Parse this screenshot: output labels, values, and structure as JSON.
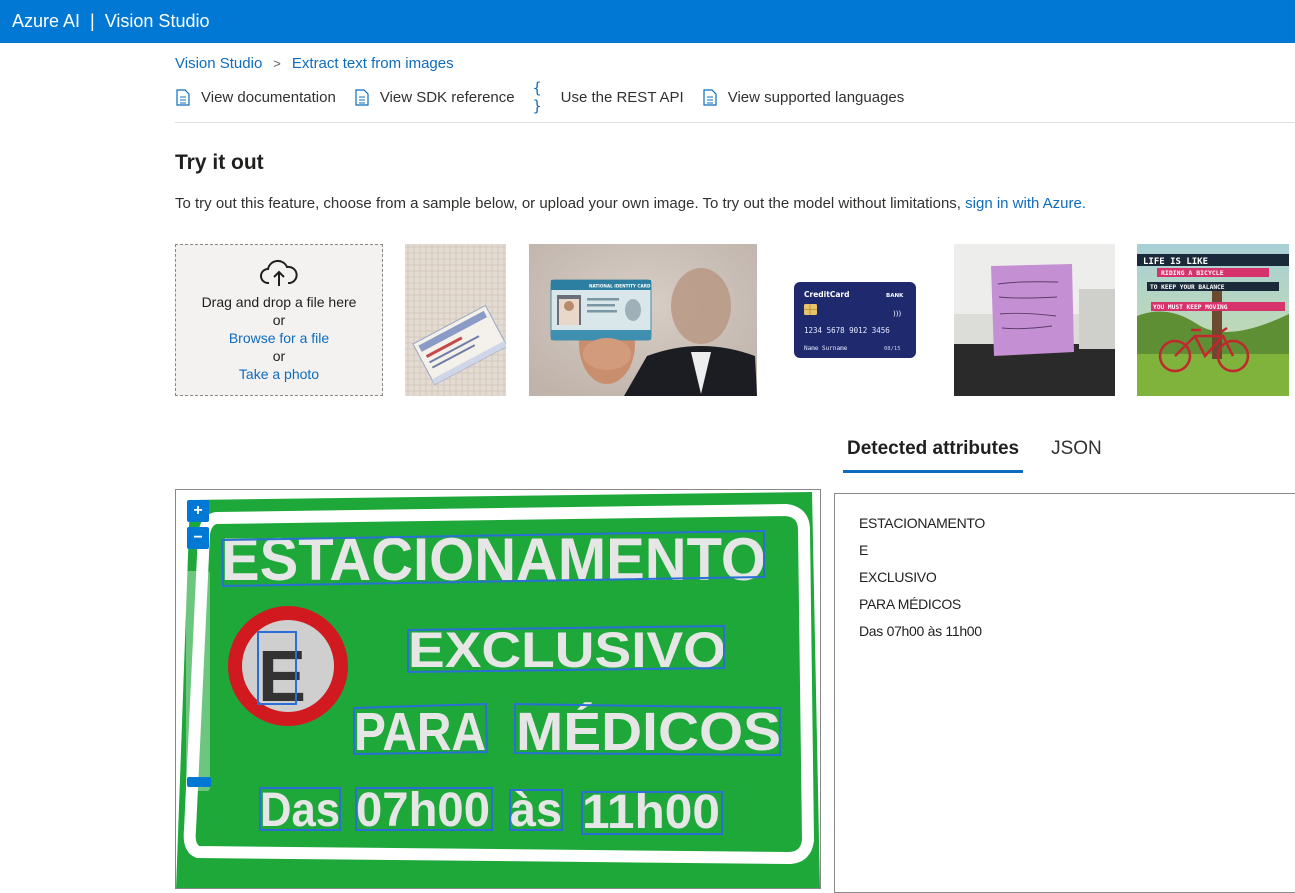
{
  "app": {
    "brand": "Azure AI",
    "separator": "|",
    "product": "Vision Studio"
  },
  "breadcrumb": {
    "root": "Vision Studio",
    "current": "Extract text from images"
  },
  "doc_links": {
    "documentation": "View documentation",
    "sdk": "View SDK reference",
    "rest": "Use the REST API",
    "languages": "View supported languages"
  },
  "section": {
    "title": "Try it out",
    "description": "To try out this feature, choose from a sample below, or upload your own image. To try out the model without limitations,",
    "signin_link": "sign in with Azure."
  },
  "upload": {
    "drag_text": "Drag and drop a file here",
    "or1": "or",
    "browse": "Browse for a file",
    "or2": "or",
    "take_photo": "Take a photo"
  },
  "samples": {
    "id_card": {
      "header": "NATIONAL IDENTITY CARD"
    },
    "credit_card": {
      "brand": "CreditCard",
      "bank": "BANK",
      "number": "1234 5678 9012 3456",
      "name": "Name Surname",
      "expiry": "08/15"
    },
    "poster": {
      "lines": [
        "LIFE IS LIKE",
        "RIDING A BICYCLE",
        "TO KEEP YOUR BALANCE",
        "YOU MUST KEEP MOVING"
      ]
    }
  },
  "tabs": {
    "detected": "Detected attributes",
    "json": "JSON",
    "active": "detected"
  },
  "viewer": {
    "zoom_in": "+",
    "zoom_out": "−",
    "sign": {
      "line1": "ESTACIONAMENTO",
      "badge": "E",
      "line2": "EXCLUSIVO",
      "line3a": "PARA",
      "line3b": "MÉDICOS",
      "line4a": "Das",
      "line4b": "07h00",
      "line4c": "às",
      "line4d": "11h00"
    }
  },
  "results": [
    "ESTACIONAMENTO",
    "E",
    "EXCLUSIVO",
    "PARA MÉDICOS",
    "Das 07h00 às 11h00"
  ],
  "colors": {
    "accent": "#0078d4",
    "link": "#0f6cbd",
    "sign_green": "#1ea83a",
    "sign_red": "#d11a20",
    "bbox": "#2b6fd6"
  }
}
